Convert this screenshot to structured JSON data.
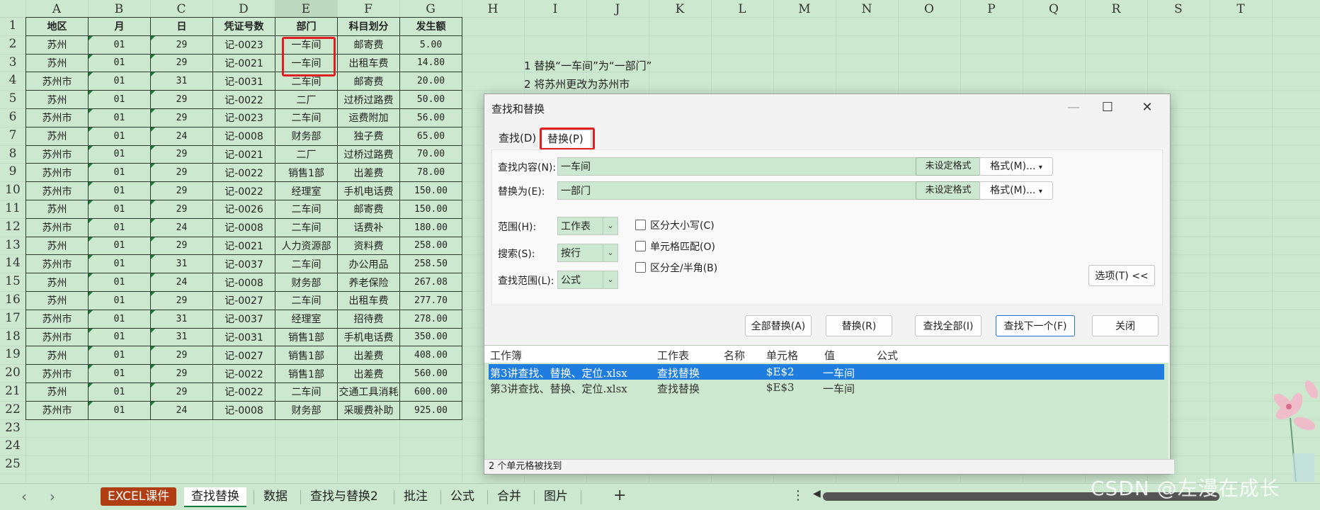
{
  "columns": [
    "A",
    "B",
    "C",
    "D",
    "E",
    "F",
    "G",
    "H",
    "I",
    "J",
    "K",
    "L",
    "M",
    "N",
    "O",
    "P",
    "Q",
    "R",
    "S",
    "T"
  ],
  "rows": [
    "1",
    "2",
    "3",
    "4",
    "5",
    "6",
    "7",
    "8",
    "9",
    "10",
    "11",
    "12",
    "13",
    "14",
    "15",
    "16",
    "17",
    "18",
    "19",
    "20",
    "21",
    "22",
    "23",
    "24",
    "25"
  ],
  "table": {
    "headers": [
      "地区",
      "月",
      "日",
      "凭证号数",
      "部门",
      "科目划分",
      "发生额"
    ],
    "rows": [
      [
        "苏州",
        "01",
        "29",
        "记-0023",
        "一车间",
        "邮寄费",
        "5.00"
      ],
      [
        "苏州",
        "01",
        "29",
        "记-0021",
        "一车间",
        "出租车费",
        "14.80"
      ],
      [
        "苏州市",
        "01",
        "31",
        "记-0031",
        "二车间",
        "邮寄费",
        "20.00"
      ],
      [
        "苏州",
        "01",
        "29",
        "记-0022",
        "二厂",
        "过桥过路费",
        "50.00"
      ],
      [
        "苏州市",
        "01",
        "29",
        "记-0023",
        "二车间",
        "运费附加",
        "56.00"
      ],
      [
        "苏州",
        "01",
        "24",
        "记-0008",
        "财务部",
        "独子费",
        "65.00"
      ],
      [
        "苏州市",
        "01",
        "29",
        "记-0021",
        "二厂",
        "过桥过路费",
        "70.00"
      ],
      [
        "苏州市",
        "01",
        "29",
        "记-0022",
        "销售1部",
        "出差费",
        "78.00"
      ],
      [
        "苏州市",
        "01",
        "29",
        "记-0022",
        "经理室",
        "手机电话费",
        "150.00"
      ],
      [
        "苏州",
        "01",
        "29",
        "记-0026",
        "二车间",
        "邮寄费",
        "150.00"
      ],
      [
        "苏州市",
        "01",
        "24",
        "记-0008",
        "二车间",
        "话费补",
        "180.00"
      ],
      [
        "苏州",
        "01",
        "29",
        "记-0021",
        "人力资源部",
        "资料费",
        "258.00"
      ],
      [
        "苏州市",
        "01",
        "31",
        "记-0037",
        "二车间",
        "办公用品",
        "258.50"
      ],
      [
        "苏州",
        "01",
        "24",
        "记-0008",
        "财务部",
        "养老保险",
        "267.08"
      ],
      [
        "苏州",
        "01",
        "29",
        "记-0027",
        "二车间",
        "出租车费",
        "277.70"
      ],
      [
        "苏州市",
        "01",
        "31",
        "记-0037",
        "经理室",
        "招待费",
        "278.00"
      ],
      [
        "苏州市",
        "01",
        "31",
        "记-0031",
        "销售1部",
        "手机电话费",
        "350.00"
      ],
      [
        "苏州",
        "01",
        "29",
        "记-0027",
        "销售1部",
        "出差费",
        "408.00"
      ],
      [
        "苏州市",
        "01",
        "29",
        "记-0022",
        "销售1部",
        "出差费",
        "560.00"
      ],
      [
        "苏州",
        "01",
        "29",
        "记-0022",
        "二车间",
        "交通工具消耗",
        "600.00"
      ],
      [
        "苏州市",
        "01",
        "24",
        "记-0008",
        "财务部",
        "采暖费补助",
        "925.00"
      ]
    ]
  },
  "notes": [
    "1 替换“一车间”为“一部门”",
    "2 将苏州更改为苏州市"
  ],
  "dialog": {
    "title": "查找和替换",
    "tab_find": "查找(D)",
    "tab_replace": "替换(P)",
    "find_label": "查找内容(N):",
    "find_value": "一车间",
    "replace_label": "替换为(E):",
    "replace_value": "一部门",
    "no_format": "未设定格式",
    "format_btn": "格式(M)...",
    "scope_label": "范围(H):",
    "scope_value": "工作表",
    "search_label": "搜索(S):",
    "search_value": "按行",
    "lookin_label": "查找范围(L):",
    "lookin_value": "公式",
    "chk_case": "区分大小写(C)",
    "chk_cell": "单元格匹配(O)",
    "chk_width": "区分全/半角(B)",
    "options_btn": "选项(T) <<",
    "btn_replace_all": "全部替换(A)",
    "btn_replace": "替换(R)",
    "btn_find_all": "查找全部(I)",
    "btn_find_next": "查找下一个(F)",
    "btn_close": "关闭",
    "results_headers": [
      "工作簿",
      "工作表",
      "名称",
      "单元格",
      "值",
      "公式"
    ],
    "results": [
      {
        "book": "第3讲查找、替换、定位.xlsx",
        "sheet": "查找替换",
        "name": "",
        "cell": "$E$2",
        "value": "一车间",
        "formula": ""
      },
      {
        "book": "第3讲查找、替换、定位.xlsx",
        "sheet": "查找替换",
        "name": "",
        "cell": "$E$3",
        "value": "一车间",
        "formula": ""
      }
    ],
    "status": "2 个单元格被找到"
  },
  "sheet_tabs": [
    "EXCEL课件",
    "查找替换",
    "数据",
    "查找与替换2",
    "批注",
    "公式",
    "合并",
    "图片"
  ],
  "add_sheet": "+",
  "watermark": "CSDN @左漫在成长"
}
